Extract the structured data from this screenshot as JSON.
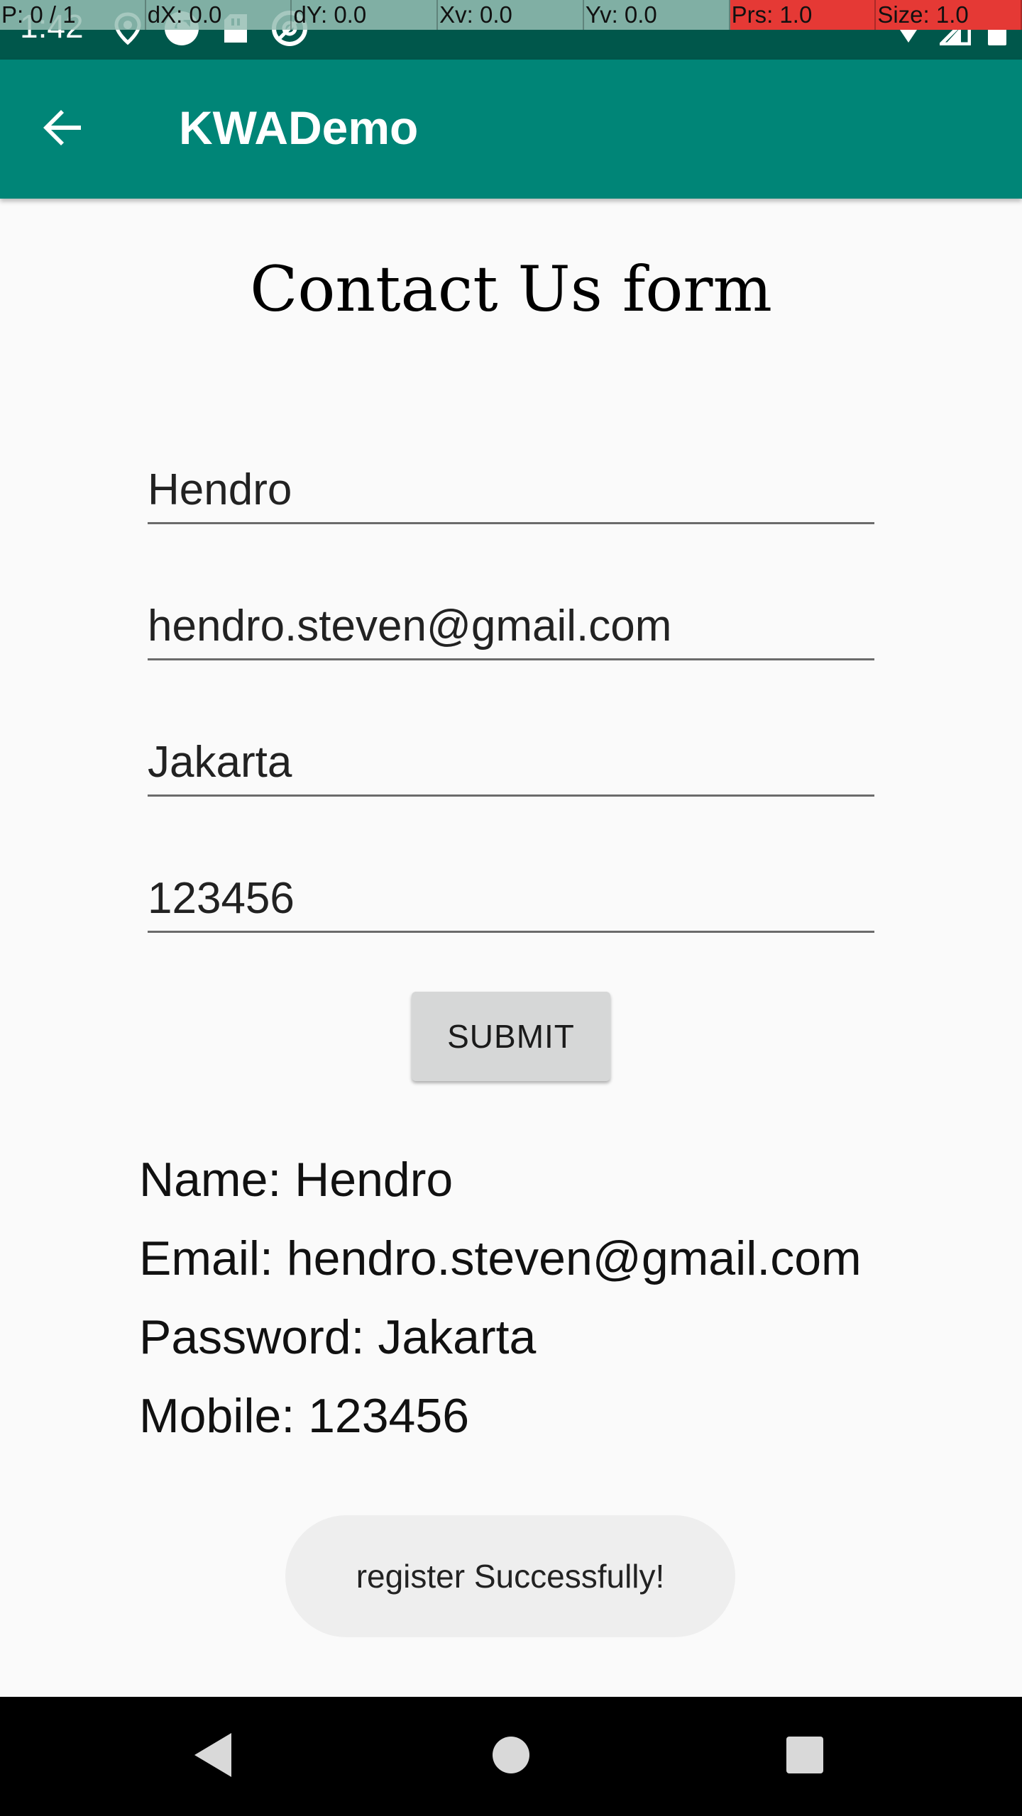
{
  "pointer_overlay": [
    "P: 0 / 1",
    "dX: 0.0",
    "dY: 0.0",
    "Xv: 0.0",
    "Yv: 0.0",
    "Prs: 1.0",
    "Size: 1.0"
  ],
  "status_bar": {
    "time": "1:42",
    "left_icons": [
      "location-icon",
      "sync-icon",
      "sd-card-icon",
      "data-saver-icon"
    ],
    "right_icons": [
      "wifi-icon",
      "signal-icon",
      "battery-icon"
    ]
  },
  "app_bar": {
    "title": "KWADemo",
    "back_icon": "arrow-back-icon"
  },
  "form": {
    "title": "Contact Us form",
    "fields": {
      "name": "Hendro",
      "email": "hendro.steven@gmail.com",
      "password": "Jakarta",
      "mobile": "123456"
    },
    "submit_label": "SUBMIT"
  },
  "result": {
    "name": "Name: Hendro",
    "email": "Email: hendro.steven@gmail.com",
    "password": "Password: Jakarta",
    "mobile": "Mobile: 123456"
  },
  "toast": {
    "message": "register Successfully!"
  },
  "nav_bar": {
    "back_icon": "nav-back-icon",
    "home_icon": "nav-home-icon",
    "recents_icon": "nav-recents-icon"
  },
  "colors": {
    "status_bar": "#00574b",
    "app_bar": "#008577",
    "background": "#fafafa",
    "button": "#d6d7d7",
    "toast": "#eeeeee"
  }
}
